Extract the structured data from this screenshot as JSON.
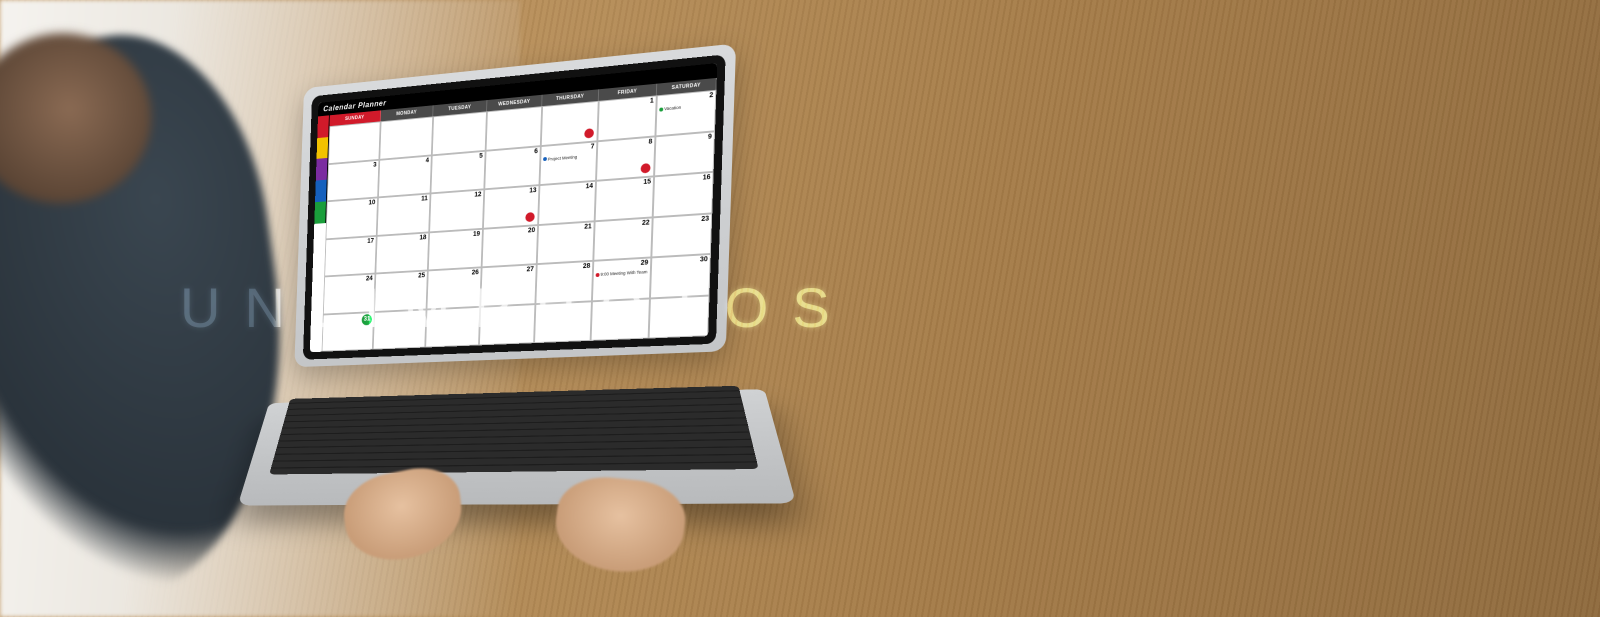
{
  "app": {
    "title": "Calendar Planner"
  },
  "sidebar": {
    "tabs": [
      {
        "color": "#d11a2a"
      },
      {
        "color": "#f2c200"
      },
      {
        "color": "#7b2ca0"
      },
      {
        "color": "#1560bd"
      },
      {
        "color": "#1a9e3b"
      }
    ]
  },
  "days_of_week": [
    {
      "label": "SUNDAY",
      "bg": "#d11a2a"
    },
    {
      "label": "MONDAY",
      "bg": "#4a4a4a"
    },
    {
      "label": "TUESDAY",
      "bg": "#4a4a4a"
    },
    {
      "label": "WEDNESDAY",
      "bg": "#4a4a4a"
    },
    {
      "label": "THURSDAY",
      "bg": "#4a4a4a"
    },
    {
      "label": "FRIDAY",
      "bg": "#4a4a4a"
    },
    {
      "label": "SATURDAY",
      "bg": "#4a4a4a"
    }
  ],
  "grid": [
    [
      {
        "day": "",
        "events": []
      },
      {
        "day": "",
        "events": []
      },
      {
        "day": "",
        "events": []
      },
      {
        "day": "",
        "events": []
      },
      {
        "day": "",
        "events": [],
        "marker": "#d11a2a"
      },
      {
        "day": "1",
        "events": []
      },
      {
        "day": "2",
        "events": [
          {
            "color": "#1a9e3b",
            "text": "Vacation"
          }
        ]
      }
    ],
    [
      {
        "day": "3",
        "events": []
      },
      {
        "day": "4",
        "events": []
      },
      {
        "day": "5",
        "events": []
      },
      {
        "day": "6",
        "events": []
      },
      {
        "day": "7",
        "events": [
          {
            "color": "#1560bd",
            "text": "Project Meeting"
          }
        ]
      },
      {
        "day": "8",
        "events": [],
        "marker": "#d11a2a"
      },
      {
        "day": "9",
        "events": []
      }
    ],
    [
      {
        "day": "10",
        "events": []
      },
      {
        "day": "11",
        "events": []
      },
      {
        "day": "12",
        "events": []
      },
      {
        "day": "13",
        "events": [],
        "marker": "#d11a2a"
      },
      {
        "day": "14",
        "events": []
      },
      {
        "day": "15",
        "events": []
      },
      {
        "day": "16",
        "events": []
      }
    ],
    [
      {
        "day": "17",
        "events": []
      },
      {
        "day": "18",
        "events": []
      },
      {
        "day": "19",
        "events": []
      },
      {
        "day": "20",
        "events": []
      },
      {
        "day": "21",
        "events": []
      },
      {
        "day": "22",
        "events": []
      },
      {
        "day": "23",
        "events": []
      }
    ],
    [
      {
        "day": "24",
        "events": []
      },
      {
        "day": "25",
        "events": []
      },
      {
        "day": "26",
        "events": []
      },
      {
        "day": "27",
        "events": []
      },
      {
        "day": "28",
        "events": []
      },
      {
        "day": "29",
        "events": [
          {
            "color": "#d11a2a",
            "text": "9:00 Meeting With Team"
          }
        ]
      },
      {
        "day": "30",
        "events": []
      }
    ],
    [
      {
        "day": "31",
        "events": [],
        "circled": "#1a9e3b"
      },
      {
        "day": "",
        "events": []
      },
      {
        "day": "",
        "events": []
      },
      {
        "day": "",
        "events": []
      },
      {
        "day": "",
        "events": []
      },
      {
        "day": "",
        "events": []
      },
      {
        "day": "",
        "events": []
      }
    ]
  ],
  "watermark": {
    "left": "UNL",
    "accent": "I",
    "right": "MPHOTOS"
  }
}
